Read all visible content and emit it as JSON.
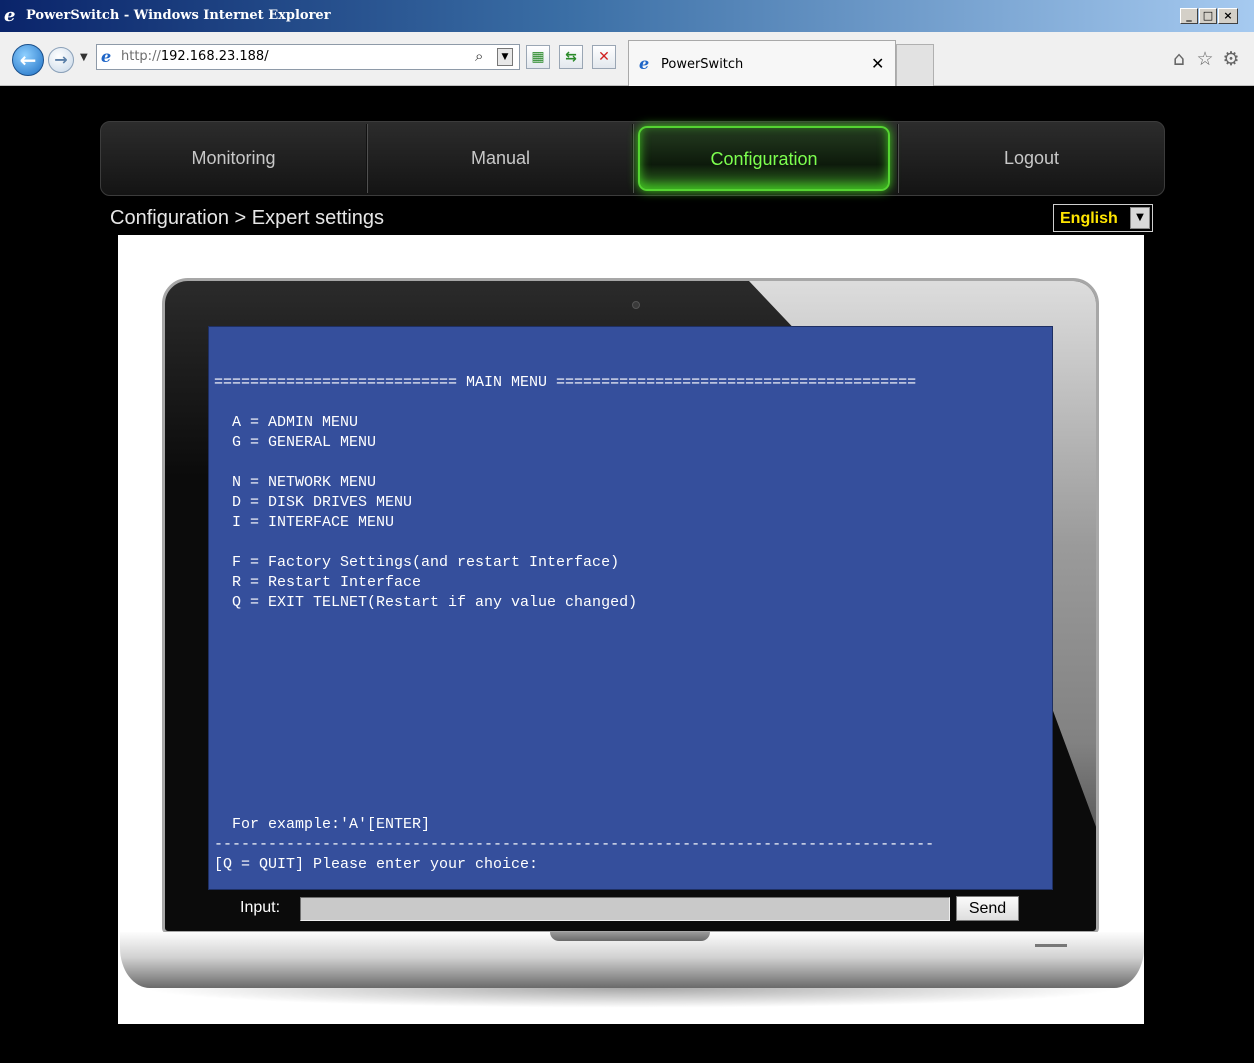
{
  "window": {
    "title": "PowerSwitch - Windows Internet Explorer",
    "minimize": "_",
    "maximize": "□",
    "close": "×"
  },
  "browser": {
    "back_glyph": "←",
    "forward_glyph": "→",
    "history_glyph": "▼",
    "address_protocol": "http://",
    "address_host": "192.168.23.188/",
    "search_glyph": "⌕",
    "dropdown_glyph": "▼",
    "compat_glyph": "▦",
    "refresh_glyph": "⇆",
    "stop_glyph": "✕",
    "tab_title": "PowerSwitch",
    "tab_close": "✕",
    "home_glyph": "⌂",
    "favorites_glyph": "☆",
    "tools_glyph": "⚙"
  },
  "nav": {
    "items": [
      {
        "label": "Monitoring"
      },
      {
        "label": "Manual"
      },
      {
        "label": "Configuration",
        "active": true
      },
      {
        "label": "Logout"
      }
    ]
  },
  "breadcrumb": "Configuration > Expert settings",
  "language": {
    "selected": "English",
    "arrow": "▼"
  },
  "terminal": {
    "header": "=========================== MAIN MENU ========================================",
    "items": [
      "  A = ADMIN MENU",
      "  G = GENERAL MENU",
      "",
      "  N = NETWORK MENU",
      "  D = DISK DRIVES MENU",
      "  I = INTERFACE MENU",
      "",
      "  F = Factory Settings(and restart Interface)",
      "  R = Restart Interface",
      "  Q = EXIT TELNET(Restart if any value changed)"
    ],
    "example": "  For example:'A'[ENTER]",
    "divider": "--------------------------------------------------------------------------------",
    "prompt": "[Q = QUIT] Please enter your choice:"
  },
  "input": {
    "label": "Input:",
    "value": "",
    "send_label": "Send"
  },
  "colors": {
    "terminal_bg": "#354f9c",
    "active_tab": "#7dff4f",
    "language_text": "#ffe500",
    "page_bg": "#000000"
  }
}
